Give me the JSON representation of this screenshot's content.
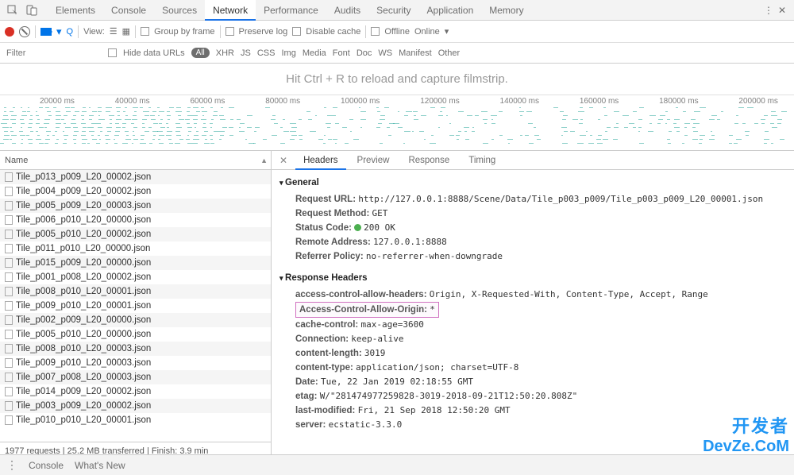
{
  "topbar": {
    "tabs": [
      "Elements",
      "Console",
      "Sources",
      "Network",
      "Performance",
      "Audits",
      "Security",
      "Application",
      "Memory"
    ],
    "active": "Network"
  },
  "toolbar": {
    "view_label": "View:",
    "group_label": "Group by frame",
    "preserve_label": "Preserve log",
    "disable_label": "Disable cache",
    "offline_label": "Offline",
    "online_label": "Online"
  },
  "filterbar": {
    "placeholder": "Filter",
    "hide_urls": "Hide data URLs",
    "all": "All",
    "types": [
      "XHR",
      "JS",
      "CSS",
      "Img",
      "Media",
      "Font",
      "Doc",
      "WS",
      "Manifest",
      "Other"
    ]
  },
  "filmstrip": {
    "hint": "Hit Ctrl + R to reload and capture filmstrip."
  },
  "timeline": {
    "ticks": [
      "20000 ms",
      "40000 ms",
      "60000 ms",
      "80000 ms",
      "100000 ms",
      "120000 ms",
      "140000 ms",
      "160000 ms",
      "180000 ms",
      "200000 ms"
    ]
  },
  "requests": {
    "header": "Name",
    "items": [
      "Tile_p013_p009_L20_00002.json",
      "Tile_p004_p009_L20_00002.json",
      "Tile_p005_p009_L20_00003.json",
      "Tile_p006_p010_L20_00000.json",
      "Tile_p005_p010_L20_00002.json",
      "Tile_p011_p010_L20_00000.json",
      "Tile_p015_p009_L20_00000.json",
      "Tile_p001_p008_L20_00002.json",
      "Tile_p008_p010_L20_00001.json",
      "Tile_p009_p010_L20_00001.json",
      "Tile_p002_p009_L20_00000.json",
      "Tile_p005_p010_L20_00000.json",
      "Tile_p008_p010_L20_00003.json",
      "Tile_p009_p010_L20_00003.json",
      "Tile_p007_p008_L20_00003.json",
      "Tile_p014_p009_L20_00002.json",
      "Tile_p003_p009_L20_00002.json",
      "Tile_p010_p010_L20_00001.json"
    ],
    "footer": "1977 requests | 25.2 MB transferred | Finish: 3.9 min"
  },
  "details": {
    "tabs": [
      "Headers",
      "Preview",
      "Response",
      "Timing"
    ],
    "active": "Headers",
    "general_title": "General",
    "general": {
      "url_k": "Request URL:",
      "url_v": "http://127.0.0.1:8888/Scene/Data/Tile_p003_p009/Tile_p003_p009_L20_00001.json",
      "method_k": "Request Method:",
      "method_v": "GET",
      "status_k": "Status Code:",
      "status_v": "200 OK",
      "remote_k": "Remote Address:",
      "remote_v": "127.0.0.1:8888",
      "ref_k": "Referrer Policy:",
      "ref_v": "no-referrer-when-downgrade"
    },
    "response_title": "Response Headers",
    "response": {
      "acah_k": "access-control-allow-headers:",
      "acah_v": "Origin, X-Requested-With, Content-Type, Accept, Range",
      "acao_k": "Access-Control-Allow-Origin:",
      "acao_v": "*",
      "cc_k": "cache-control:",
      "cc_v": "max-age=3600",
      "conn_k": "Connection:",
      "conn_v": "keep-alive",
      "cl_k": "content-length:",
      "cl_v": "3019",
      "ct_k": "content-type:",
      "ct_v": "application/json; charset=UTF-8",
      "date_k": "Date:",
      "date_v": "Tue, 22 Jan 2019 02:18:55 GMT",
      "etag_k": "etag:",
      "etag_v": "W/\"281474977259828-3019-2018-09-21T12:50:20.808Z\"",
      "lm_k": "last-modified:",
      "lm_v": "Fri, 21 Sep 2018 12:50:20 GMT",
      "srv_k": "server:",
      "srv_v": "ecstatic-3.3.0"
    }
  },
  "drawer": {
    "console": "Console",
    "whatsnew": "What's New"
  },
  "watermark": {
    "zh": "开发者",
    "en": "DevZe.CoM"
  }
}
